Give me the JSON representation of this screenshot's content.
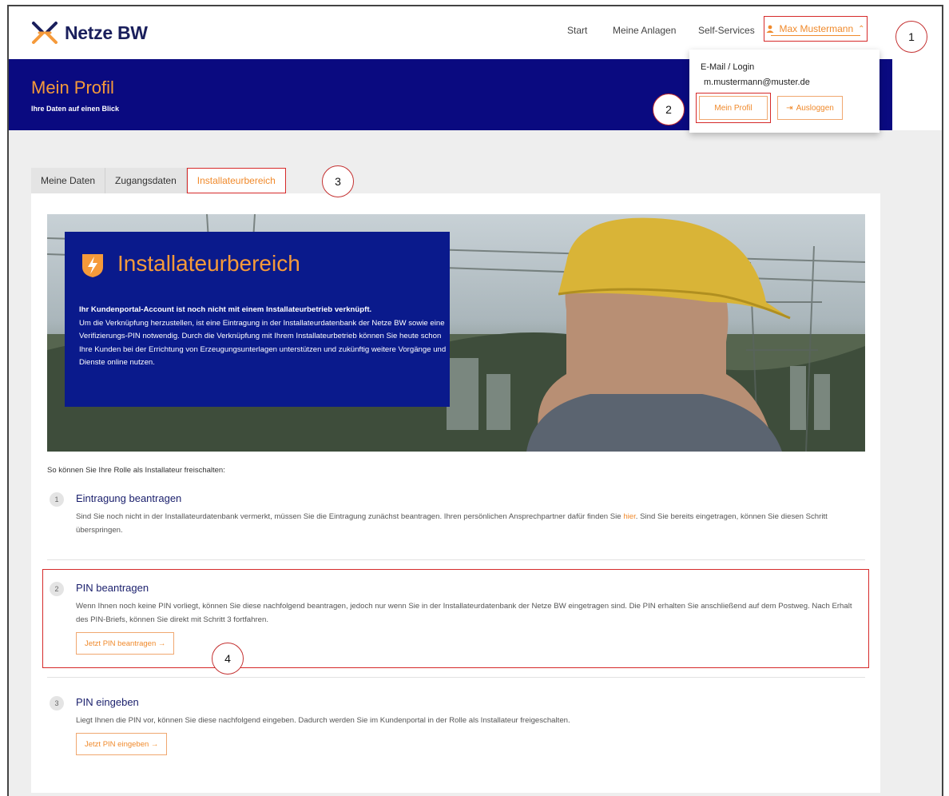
{
  "header": {
    "logo_text": "Netze BW",
    "nav": [
      "Start",
      "Meine Anlagen",
      "Self-Services"
    ],
    "user_name": "Max Mustermann"
  },
  "dropdown": {
    "label": "E-Mail / Login",
    "email": "m.mustermann@muster.de",
    "profile_button": "Mein Profil",
    "logout_button": "Ausloggen"
  },
  "band": {
    "title": "Mein Profil",
    "subtitle": "Ihre Daten auf einen Blick"
  },
  "tabs": [
    "Meine Daten",
    "Zugangsdaten",
    "Installateurbereich"
  ],
  "active_tab": "Installateurbereich",
  "hero": {
    "title": "Installateurbereich",
    "bold_text": "Ihr Kundenportal-Account ist noch nicht mit einem Installateurbetrieb verknüpft.",
    "text": "Um die Verknüpfung herzustellen, ist eine Eintragung in der Installateurdatenbank der Netze BW sowie eine Verifizierungs-PIN notwendig. Durch die Verknüpfung mit Ihrem Installateurbetrieb können Sie heute schon Ihre Kunden bei der Errichtung von Erzeugungsunterlagen unterstützen und zukünftig weitere Vorgänge und Dienste online nutzen."
  },
  "intro": "So können Sie Ihre Rolle als Installateur freischalten:",
  "steps": [
    {
      "number": "1",
      "title": "Eintragung beantragen",
      "text_before": "Sind Sie noch nicht in der Installateurdatenbank vermerkt, müssen Sie die Eintragung zunächst beantragen. Ihren persönlichen Ansprechpartner dafür finden Sie ",
      "link": "hier",
      "text_after": ". Sind Sie bereits eingetragen, können Sie diesen Schritt überspringen."
    },
    {
      "number": "2",
      "title": "PIN beantragen",
      "text": "Wenn Ihnen noch keine PIN vorliegt, können Sie diese nachfolgend beantragen, jedoch nur wenn Sie in der Installateurdatenbank der Netze BW eingetragen sind. Die PIN erhalten Sie anschließend auf dem Postweg. Nach Erhalt des PIN-Briefs, können Sie direkt mit Schritt 3 fortfahren.",
      "button": "Jetzt PIN beantragen →"
    },
    {
      "number": "3",
      "title": "PIN eingeben",
      "text": "Liegt Ihnen die PIN vor, können Sie diese nachfolgend eingeben. Dadurch werden Sie im Kundenportal in der Rolle als Installateur freigeschalten.",
      "button": "Jetzt PIN eingeben →"
    }
  ],
  "markers": [
    "1",
    "2",
    "3",
    "4"
  ],
  "colors": {
    "brand_navy": "#0a0a80",
    "accent_orange": "#f08a2c",
    "annotation_red": "#d62a2a"
  }
}
